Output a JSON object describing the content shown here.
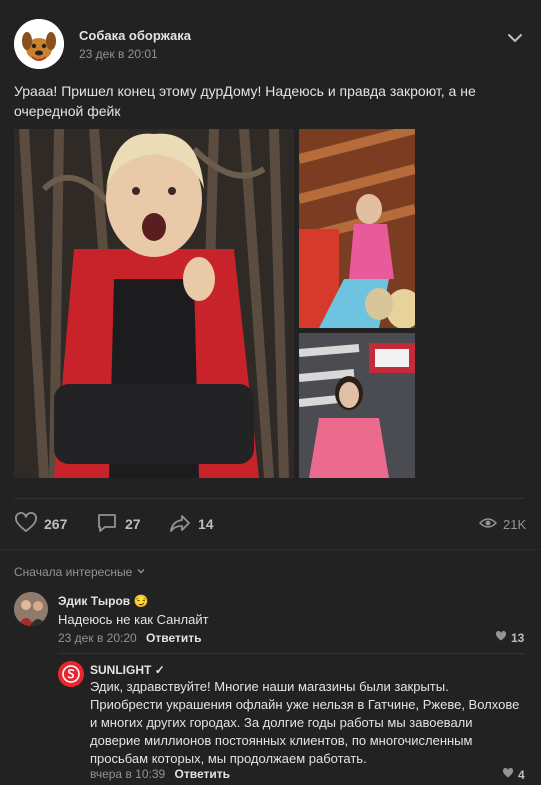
{
  "post": {
    "author": "Собака оборжака",
    "date": "23 дек в 20:01",
    "text": "Урааа! Пришел конец этому дурДому! Надеюсь и правда закроют, а не очередной фейк",
    "likes": "267",
    "comments": "27",
    "shares": "14",
    "views": "21K"
  },
  "comments_section": {
    "sort_label": "Сначала интересные"
  },
  "comments": [
    {
      "author": "Эдик Тыров",
      "emoji": "😏",
      "text": "Надеюсь не как Санлайт",
      "date": "23 дек в 20:20",
      "reply_label": "Ответить",
      "likes": "13"
    }
  ],
  "reply": {
    "author": "SUNLIGHT",
    "verified_mark": "✓",
    "text": "Эдик, здравствуйте! Многие наши магазины были закрыты. Приобрести украшения офлайн уже нельзя в Гатчине, Ржеве, Волхове и многих других городах. За долгие годы работы мы завоевали доверие миллионов постоянных клиентов, по многочисленным просьбам которых, мы продолжаем работать.",
    "date": "вчера в 10:39",
    "reply_label": "Ответить",
    "likes": "4"
  },
  "colors": {
    "background": "#222222",
    "text": "#e1e3e6",
    "muted": "#939393",
    "sunlight_red": "#e8262e"
  }
}
